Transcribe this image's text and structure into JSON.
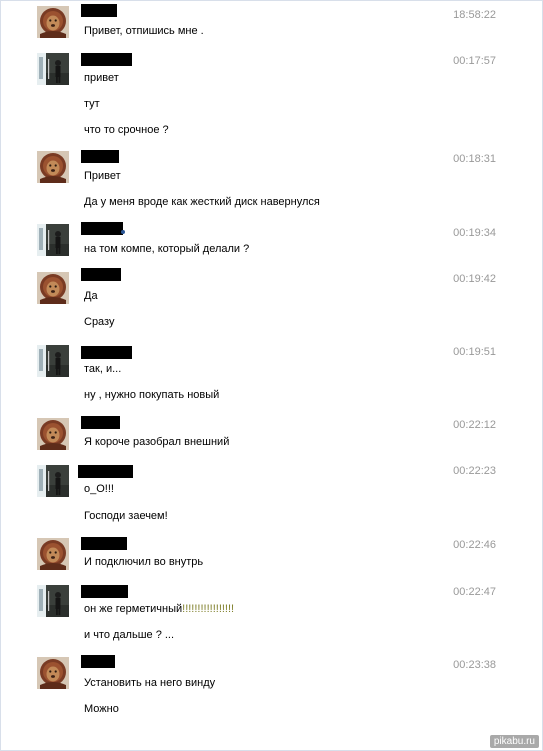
{
  "colors": {
    "time_text": "#999999",
    "redaction": "#000000",
    "highlight_excl": "#7f7f2a"
  },
  "avatars": {
    "lion": "lion-avatar-icon",
    "person": "person-avatar-icon"
  },
  "messages": [
    {
      "avatar": "lion",
      "time": "18:58:22",
      "lines": [
        "Привет, отпишись мне ."
      ]
    },
    {
      "avatar": "person",
      "time": "00:17:57",
      "lines": [
        "привет",
        "тут",
        "что то срочное ?"
      ]
    },
    {
      "avatar": "lion",
      "time": "00:18:31",
      "lines": [
        "Привет",
        "Да у меня вроде как жесткий диск навернулся"
      ]
    },
    {
      "avatar": "person",
      "time": "00:19:34",
      "lines": [
        "на том компе, который делали ?"
      ]
    },
    {
      "avatar": "lion",
      "time": "00:19:42",
      "lines": [
        "Да",
        "Сразу"
      ]
    },
    {
      "avatar": "person",
      "time": "00:19:51",
      "lines": [
        "так, и...",
        "ну , нужно покупать новый"
      ]
    },
    {
      "avatar": "lion",
      "time": "00:22:12",
      "lines": [
        "Я короче разобрал внешний"
      ]
    },
    {
      "avatar": "person",
      "time": "00:22:23",
      "lines": [
        "о_О!!!",
        "Господи заечем!"
      ]
    },
    {
      "avatar": "lion",
      "time": "00:22:46",
      "lines": [
        "И подключил во внутрь"
      ]
    },
    {
      "avatar": "person",
      "time": "00:22:47",
      "lines_rich": [
        {
          "text": "он же герметичный",
          "excl": "!!!!!!!!!!!!!!!!!"
        }
      ],
      "lines": [
        "и что дальше ? ..."
      ]
    },
    {
      "avatar": "lion",
      "time": "00:23:38",
      "lines": [
        "Установить на него винду",
        "Можно"
      ]
    }
  ],
  "watermark": "pikabu.ru"
}
